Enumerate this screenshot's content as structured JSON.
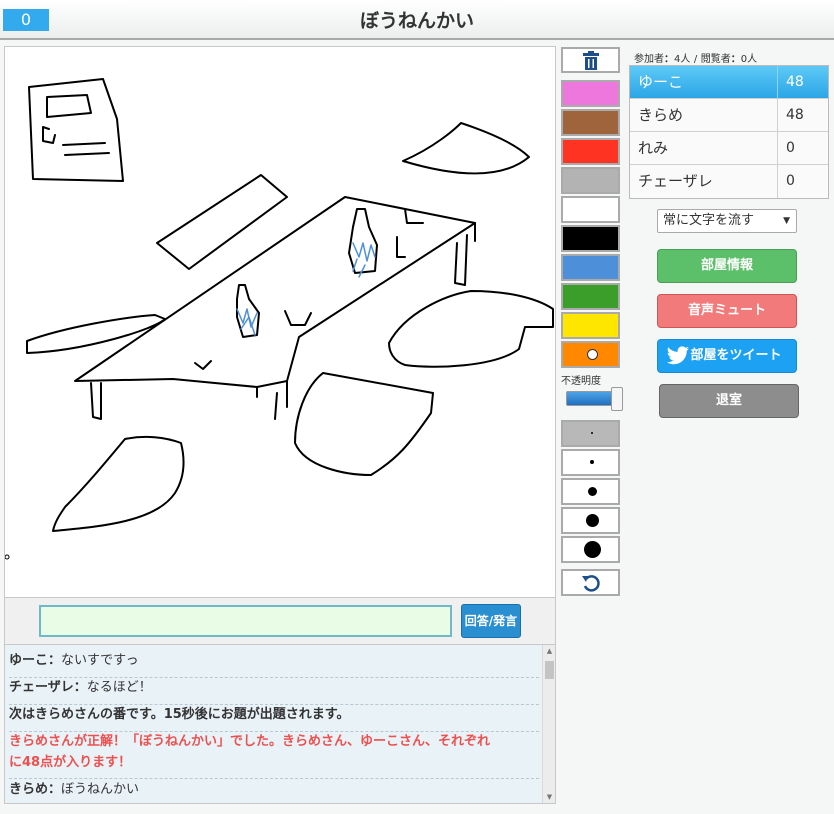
{
  "header": {
    "timer": "0",
    "title": "ぼうねんかい"
  },
  "answer": {
    "value": "",
    "placeholder": "",
    "button_label": "回答/発言"
  },
  "chat": [
    {
      "speaker": "ゆーこ",
      "sep": "：",
      "text": "ないすですっ",
      "style": "normal"
    },
    {
      "speaker": "チェーザレ",
      "sep": "：",
      "text": "なるほど！",
      "style": "normal"
    },
    {
      "speaker": "",
      "sep": "",
      "text": "次はきらめさんの番です。15秒後にお題が出題されます。",
      "style": "bold"
    },
    {
      "speaker": "",
      "sep": "",
      "text_line1": "きらめさんが正解！「ぼうねんかい」でした。きらめさん、ゆーこさん、それぞれ",
      "text_line2": "に48点が入ります！",
      "style": "red"
    },
    {
      "speaker": "きらめ",
      "sep": "：",
      "text": "ぼうねんかい",
      "style": "normal"
    }
  ],
  "palette": {
    "colors": [
      "#ee77dd",
      "#a0643c",
      "#ff3322",
      "#b3b3b3",
      "#ffffff",
      "#000000",
      "#4d90d9",
      "#3c9e2a",
      "#ffe600",
      "#ff8800"
    ],
    "selected_index": 9
  },
  "opacity": {
    "label": "不透明度",
    "value": 1.0
  },
  "pen_sizes": {
    "selected_index": 0
  },
  "participants": {
    "label_participants": "参加者",
    "participants_count": "4人",
    "separator": "/",
    "label_viewers": "閲覧者",
    "viewers_count": "0人",
    "list": [
      {
        "name": "ゆーこ",
        "score": "48",
        "active": true
      },
      {
        "name": "きらめ",
        "score": "48",
        "active": false
      },
      {
        "name": "れみ",
        "score": "0",
        "active": false
      },
      {
        "name": "チェーザレ",
        "score": "0",
        "active": false
      }
    ]
  },
  "scroll_option": {
    "selected": "常に文字を流す"
  },
  "buttons": {
    "room_info": "部屋情報",
    "mute": "音声ミュート",
    "tweet": "部屋をツイート",
    "exit": "退室"
  },
  "icons": {
    "trash": "trash-icon",
    "undo": "undo-icon",
    "twitter": "twitter-bird-icon"
  }
}
